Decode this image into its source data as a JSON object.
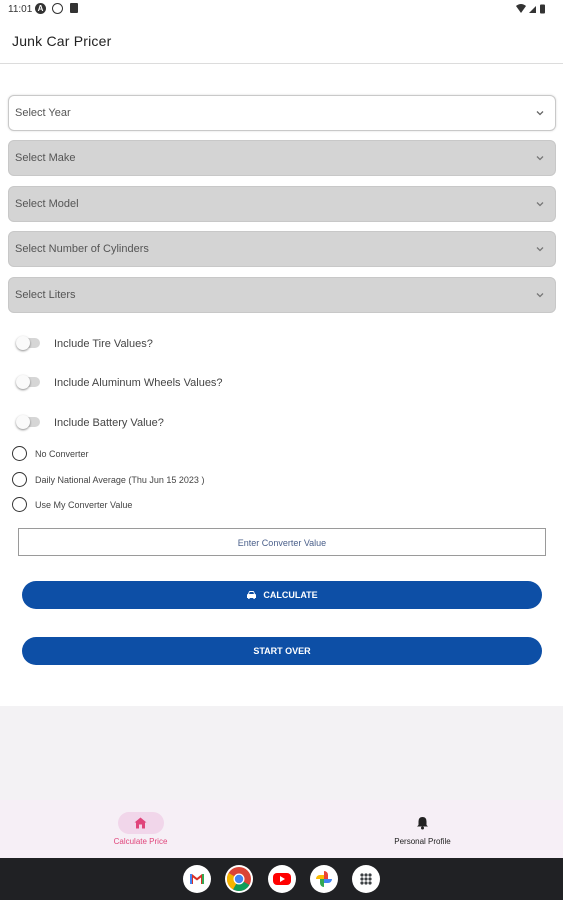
{
  "status_bar": {
    "time": "11:01"
  },
  "app_bar": {
    "title": "Junk Car Pricer"
  },
  "selects": [
    {
      "label": "Select Year"
    },
    {
      "label": "Select Make"
    },
    {
      "label": "Select Model"
    },
    {
      "label": "Select Number of Cylinders"
    },
    {
      "label": "Select Liters"
    }
  ],
  "toggles": [
    {
      "label": "Include Tire Values?",
      "on": false
    },
    {
      "label": "Include Aluminum Wheels Values?",
      "on": false
    },
    {
      "label": "Include Battery Value?",
      "on": false
    }
  ],
  "radios": [
    {
      "label": "No Converter",
      "selected": false
    },
    {
      "label": "Daily National Average (Thu Jun 15 2023 )",
      "selected": false
    },
    {
      "label": "Use My Converter Value",
      "selected": false
    }
  ],
  "converter_input": {
    "placeholder": "Enter Converter Value"
  },
  "buttons": {
    "calculate": "CALCULATE",
    "start_over": "START OVER"
  },
  "bottom_nav": [
    {
      "label": "Calculate Price",
      "icon": "home-icon",
      "active": true
    },
    {
      "label": "Personal Profile",
      "icon": "bell-icon",
      "active": false
    }
  ],
  "colors": {
    "primary_button": "#0d4fa6",
    "nav_active": "#e0457b",
    "nav_bg": "#f6eff6"
  },
  "dock_apps": [
    "gmail-icon",
    "chrome-icon",
    "youtube-icon",
    "photos-icon",
    "app-drawer-icon"
  ]
}
